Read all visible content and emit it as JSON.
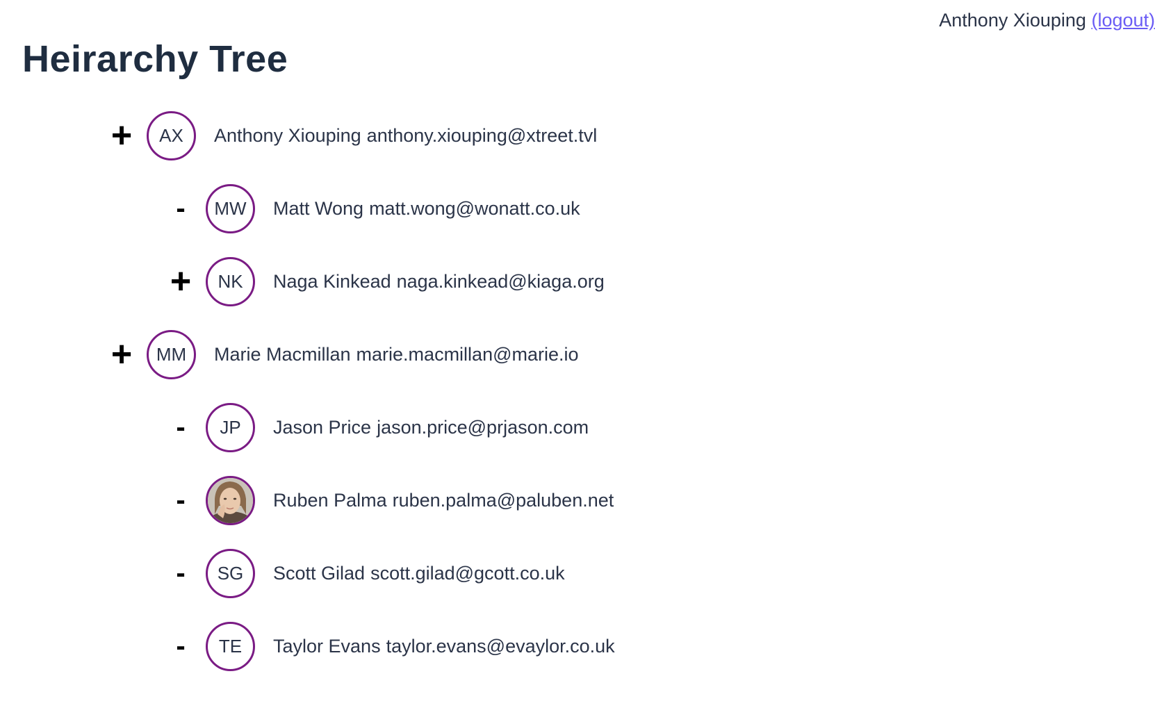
{
  "header": {
    "current_user": "Anthony Xiouping",
    "logout_label": "(logout)"
  },
  "page": {
    "title": "Heirarchy Tree"
  },
  "colors": {
    "avatar_ring": "#7a1b84",
    "logout_link": "#6a5cf5",
    "title": "#1f2d40",
    "text": "#2b3448"
  },
  "tree": [
    {
      "toggle": "+",
      "initials": "AX",
      "name": "Anthony Xiouping",
      "email": "anthony.xiouping@xtreet.tvl",
      "level": 0,
      "expanded": false,
      "avatar_type": "initials"
    },
    {
      "toggle": "-",
      "initials": "MW",
      "name": "Matt Wong",
      "email": "matt.wong@wonatt.co.uk",
      "level": 1,
      "expanded": true,
      "avatar_type": "initials"
    },
    {
      "toggle": "+",
      "initials": "NK",
      "name": "Naga Kinkead",
      "email": "naga.kinkead@kiaga.org",
      "level": 1,
      "expanded": false,
      "avatar_type": "initials"
    },
    {
      "toggle": "+",
      "initials": "MM",
      "name": "Marie Macmillan",
      "email": "marie.macmillan@marie.io",
      "level": 0,
      "expanded": false,
      "avatar_type": "initials"
    },
    {
      "toggle": "-",
      "initials": "JP",
      "name": "Jason Price",
      "email": "jason.price@prjason.com",
      "level": 1,
      "expanded": true,
      "avatar_type": "initials"
    },
    {
      "toggle": "-",
      "initials": "",
      "name": "Ruben Palma",
      "email": "ruben.palma@paluben.net",
      "level": 1,
      "expanded": true,
      "avatar_type": "photo"
    },
    {
      "toggle": "-",
      "initials": "SG",
      "name": "Scott Gilad",
      "email": "scott.gilad@gcott.co.uk",
      "level": 1,
      "expanded": true,
      "avatar_type": "initials"
    },
    {
      "toggle": "-",
      "initials": "TE",
      "name": "Taylor Evans",
      "email": "taylor.evans@evaylor.co.uk",
      "level": 1,
      "expanded": true,
      "avatar_type": "initials"
    }
  ]
}
